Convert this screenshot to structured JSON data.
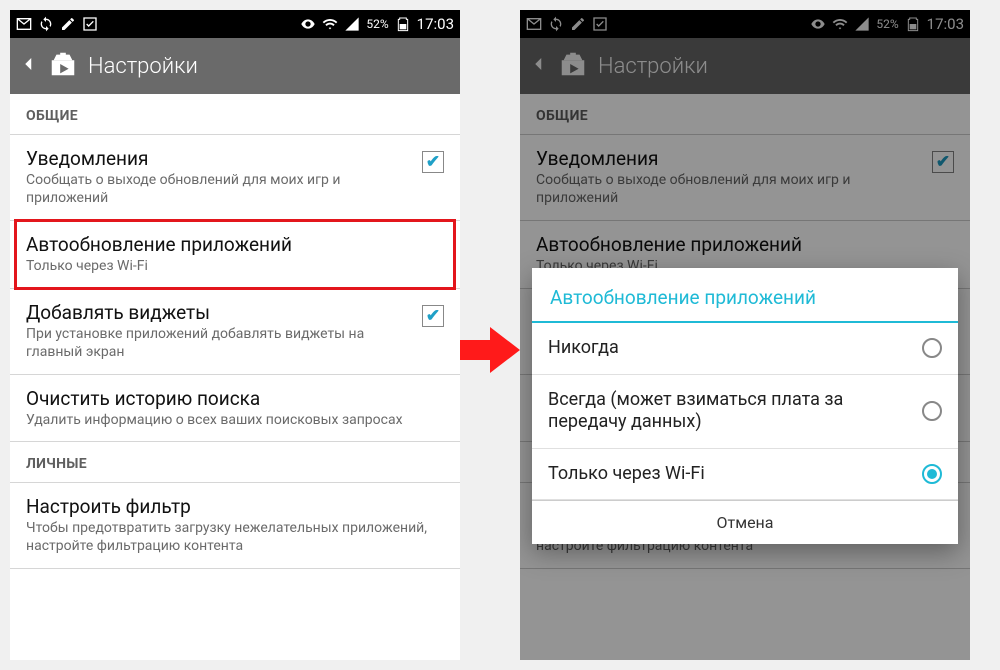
{
  "status": {
    "battery_pct": "52%",
    "time": "17:03"
  },
  "header": {
    "title": "Настройки"
  },
  "sections": {
    "general": "ОБЩИЕ",
    "personal": "ЛИЧНЫЕ"
  },
  "rows": {
    "notifications": {
      "title": "Уведомления",
      "sub": "Сообщать о выходе обновлений для моих игр и приложений"
    },
    "autoupdate": {
      "title": "Автообновление приложений",
      "sub": "Только через Wi-Fi"
    },
    "widgets": {
      "title": "Добавлять виджеты",
      "sub": "При установке приложений добавлять виджеты на главный экран"
    },
    "clear_search": {
      "title": "Очистить историю поиска",
      "sub": "Удалить информацию о всех ваших поисковых запросах"
    },
    "filter": {
      "title": "Настроить фильтр",
      "sub": "Чтобы предотвратить загрузку нежелательных приложений, настройте фильтрацию контента"
    }
  },
  "dialog": {
    "title": "Автообновление приложений",
    "options": {
      "never": "Никогда",
      "always": "Всегда (может взиматься плата за передачу данных)",
      "wifi": "Только через Wi-Fi"
    },
    "cancel": "Отмена"
  }
}
